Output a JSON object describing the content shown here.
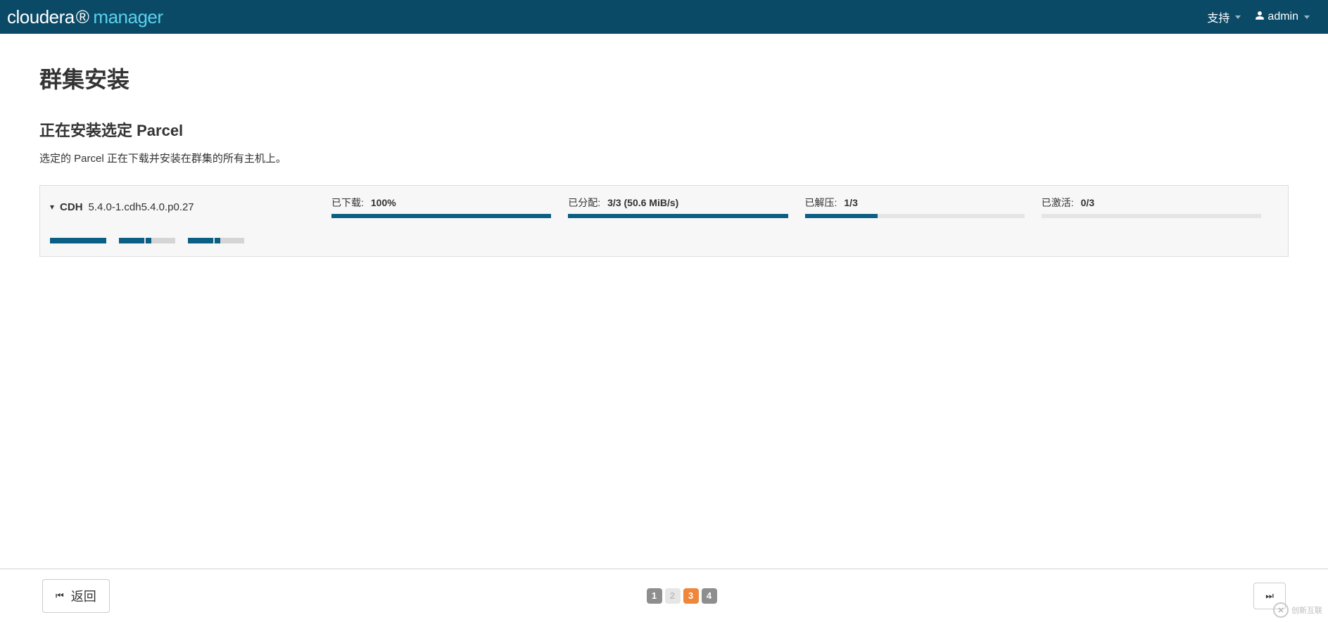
{
  "navbar": {
    "brand_cloudera": "cloudera",
    "brand_manager": "manager",
    "support_label": "支持",
    "user_label": "admin"
  },
  "page": {
    "title": "群集安装",
    "sub_title": "正在安装选定 Parcel",
    "description": "选定的 Parcel 正在下载并安装在群集的所有主机上。"
  },
  "parcel": {
    "name": "CDH",
    "version": "5.4.0-1.cdh5.4.0.p0.27",
    "metrics": {
      "downloaded": {
        "label": "已下载:",
        "value": "100%",
        "percent": 100
      },
      "distributed": {
        "label": "已分配:",
        "value": "3/3 (50.6 MiB/s)",
        "percent": 100
      },
      "unpacked": {
        "label": "已解压:",
        "value": "1/3",
        "percent": 33
      },
      "activated": {
        "label": "已激活:",
        "value": "0/3",
        "percent": 0
      }
    },
    "hosts": [
      {
        "done": 100,
        "active": 0
      },
      {
        "done": 45,
        "active": 10
      },
      {
        "done": 45,
        "active": 10
      }
    ]
  },
  "wizard": {
    "back_label": "返回",
    "steps": [
      "1",
      "2",
      "3",
      "4"
    ],
    "current_step_index": 2,
    "disabled_step_indices": [
      1
    ]
  },
  "watermark": {
    "text": "创新互联"
  }
}
